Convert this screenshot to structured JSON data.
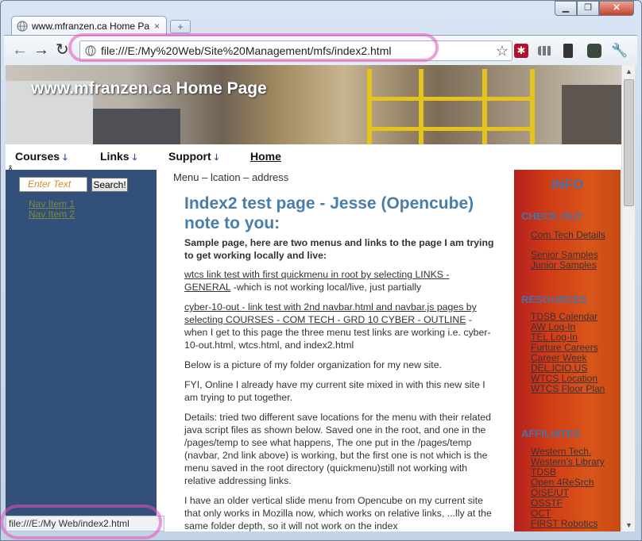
{
  "browser": {
    "tab_title": "www.mfranzen.ca Home Pa",
    "tab_close": "×",
    "new_tab": "+",
    "url": "file:///E:/My%20Web/Site%20Management/mfs/index2.html",
    "status_url": "file:///E:/My Web/index2.html",
    "window_buttons": [
      "▁",
      "❐",
      "✕"
    ],
    "icons": [
      "back-icon",
      "forward-icon",
      "reload-icon",
      "page-icon",
      "star-icon",
      "lastpass-icon",
      "apps-icon",
      "phone-icon",
      "evernote-icon",
      "wrench-icon"
    ]
  },
  "site": {
    "banner_title": "www.mfranzen.ca Home Page",
    "menu": [
      {
        "label": "Courses",
        "arrow": "🡓"
      },
      {
        "label": "Links",
        "arrow": "🡓"
      },
      {
        "label": "Support",
        "arrow": "🡓"
      },
      {
        "label": "Home",
        "arrow": ""
      }
    ],
    "stray_char": "Â",
    "search": {
      "placeholder": "Enter Text",
      "button": "Search!"
    },
    "left_nav": [
      "Nav Item 1",
      "Nav Item 2"
    ],
    "breadcrumb": "Menu – lcation – address",
    "heading": "Index2 test page - Jesse (Opencube) note to you:",
    "intro": "Sample page, here are two menus and links to the page I am trying to get working locally and live:",
    "p1_link": "wtcs link test with first quickmenu in root by selecting LINKS - GENERAL",
    "p1_rest": " -which is not working local/live, just partially",
    "p2_link": "cyber-10-out - link test with 2nd navbar.html and navbar.js pages by selecting COURSES - COM TECH - GRD 10 CYBER - OUTLINE",
    "p2_rest": " - when I get to this page the three menu test links are working i.e. cyber-10-out.html, wtcs.html, and index2.html",
    "p3": "Below is a picture of my folder organization for my new site.",
    "p4": "FYI, Online I already have my current site mixed in with this new site I am trying to put together.",
    "p5": "Details: tried two different save locations for the menu with their related java script files as shown below. Saved one in the root, and one in the /pages/temp to see what happens, The one put in the /pages/temp (navbar, 2nd link above) is working, but the first one is not which is the menu saved in the root directory (quickmenu)still not working with relative addressing links.",
    "p6": "I have an older vertical slide menu from Opencube on my current site that only works in Mozilla now, which works on relative links, ...lly at the same folder depth, so it will not work on the index"
  },
  "sidebar_right": {
    "title": "INFO",
    "sections": [
      {
        "title": "CHECK OUT",
        "links": [
          "Com Tech Details",
          "Senior Samples",
          "Junior Samples"
        ]
      },
      {
        "title": "RESOURCES",
        "links": [
          "TDSB Calendar",
          "AW Log-In",
          "TEL Log-In",
          "Furture Careers",
          "Career Week",
          "DEL.ICIO.US",
          "WTCS Location",
          "WTCS Floor Plan"
        ]
      },
      {
        "title": "AFFILIATES",
        "links": [
          "Western Tech.",
          "Western's Library",
          "TDSB",
          "Open 4ReSrch",
          "OISE/UT",
          "OSSTF",
          "OCT",
          "FIRST Robotics"
        ]
      }
    ]
  }
}
